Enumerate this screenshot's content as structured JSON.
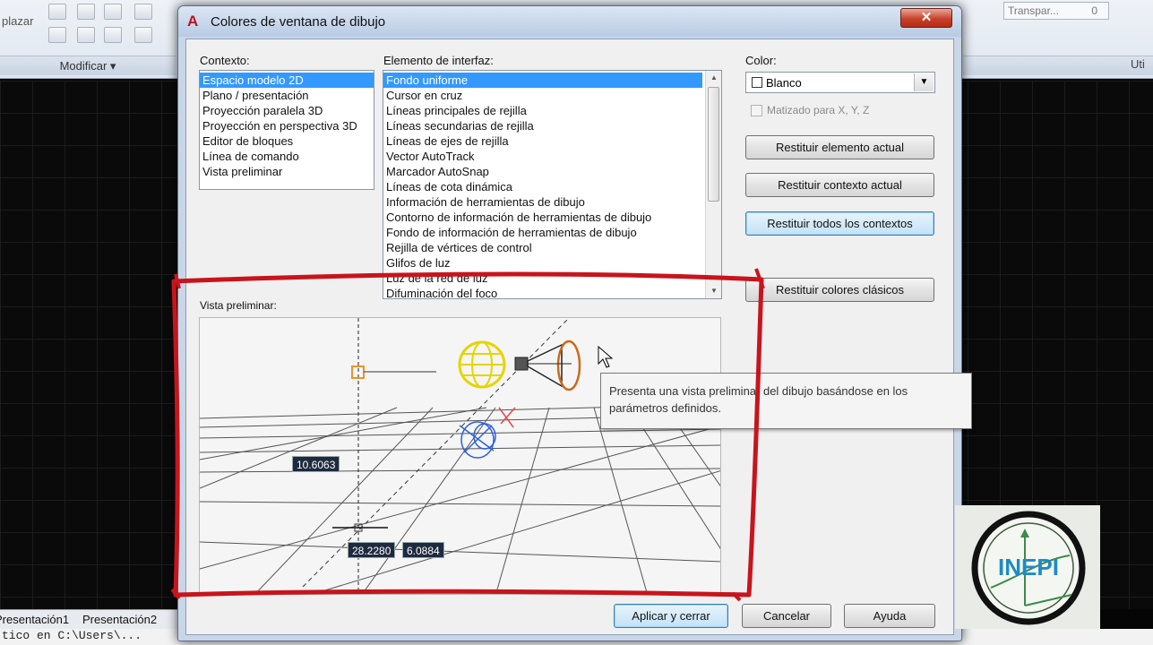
{
  "ribbon": {
    "left_text": "plazar",
    "modify_panel_title": "Modificar ▾",
    "transparency_placeholder": "Transpar...",
    "transparency_value": "0",
    "util_label": "Uti"
  },
  "dialog": {
    "title": "Colores de ventana de dibujo",
    "close_label": "✕",
    "context": {
      "label": "Contexto:",
      "items": [
        "Espacio modelo 2D",
        "Plano / presentación",
        "Proyección paralela 3D",
        "Proyección en perspectiva 3D",
        "Editor de bloques",
        "Línea de comando",
        "Vista preliminar"
      ],
      "selected_index": 0
    },
    "interface": {
      "label": "Elemento de interfaz:",
      "items": [
        "Fondo uniforme",
        "Cursor en cruz",
        "Líneas principales de rejilla",
        "Líneas secundarias de rejilla",
        "Líneas de ejes de rejilla",
        "Vector AutoTrack",
        "Marcador AutoSnap",
        "Líneas de cota dinámica",
        "Información de herramientas de dibujo",
        "Contorno de información de herramientas de dibujo",
        "Fondo de información de herramientas de dibujo",
        "Rejilla de vértices de control",
        "Glifos de luz",
        "Luz de la red de luz",
        "Difuminación del foco"
      ],
      "selected_index": 0
    },
    "color": {
      "label": "Color:",
      "value": "Blanco",
      "swatch": "#ffffff",
      "tint_label": "Matizado para X, Y, Z"
    },
    "buttons": {
      "restore_element": "Restituir elemento actual",
      "restore_context": "Restituir contexto actual",
      "restore_all": "Restituir todos los contextos",
      "restore_classic": "Restituir colores clásicos",
      "apply_close": "Aplicar y cerrar",
      "cancel": "Cancelar",
      "help": "Ayuda"
    },
    "preview": {
      "label": "Vista preliminar:",
      "dim1": "10.6063",
      "dim2": "28.2280",
      "dim3": "6.0884"
    },
    "tooltip": "Presenta una vista preliminar del dibujo basándose en los parámetros definidos."
  },
  "layout_tabs": [
    "Presentación1",
    "Presentación2"
  ],
  "command_line": "tico en C:\\Users\\...",
  "logo": {
    "text": "INEPI"
  },
  "colors": {
    "annotation_red": "#c8141c",
    "selection_blue": "#3399ff",
    "sun_yellow": "#f0e000"
  }
}
